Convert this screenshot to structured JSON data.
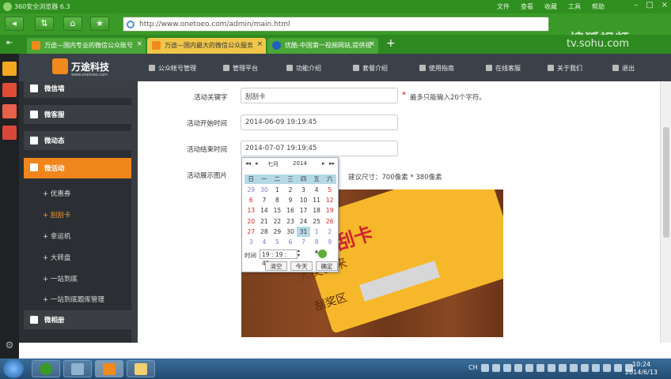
{
  "browser": {
    "title": "360安全浏览器 6.3",
    "menus": [
      "文件",
      "查看",
      "收藏",
      "工具",
      "帮助"
    ],
    "url": "http://www.onetoeo.com/admin/main.html",
    "watermark": "搜狐视频",
    "watermark_url": "tv.sohu.com",
    "tabs": [
      {
        "label": "万途—国内专业的微信公众账号"
      },
      {
        "label": "万途—国内最大的微信公众服务"
      },
      {
        "label": "优酷-中国第一视频网站,提供视"
      }
    ]
  },
  "site": {
    "brand": "万途科技",
    "brand_sub": "www.onetoeo.com",
    "nav": [
      "公众帐号管理",
      "管理平台",
      "功能介绍",
      "套餐介绍",
      "使用指南",
      "在线客服",
      "关于我们",
      "退出"
    ]
  },
  "sidebar": {
    "items": [
      "微信墙",
      "微客服",
      "微动态",
      "微活动",
      "微相册"
    ],
    "subitems": [
      "优惠券",
      "刮刮卡",
      "幸运机",
      "大转盘",
      "一站到底",
      "一站到底题库管理"
    ]
  },
  "form": {
    "keyword_label": "活动关键字",
    "keyword_value": "刮刮卡",
    "keyword_hint": "最多只能输入20个字符。",
    "start_label": "活动开始时间",
    "start_value": "2014-06-09 19:19:45",
    "end_label": "活动结束时间",
    "end_value": "2014-07-07 19:19:45",
    "image_label": "活动展示图片",
    "image_hint": "建议尺寸：700像素 * 380像素",
    "image_text_title": "刮卡",
    "image_text_mid": "大奖出来",
    "image_text_area": "刮奖区"
  },
  "calendar": {
    "month": "七月",
    "year": "2014",
    "weekdays": [
      "日",
      "一",
      "二",
      "三",
      "四",
      "五",
      "六"
    ],
    "days": [
      {
        "d": "29",
        "o": true
      },
      {
        "d": "30",
        "o": true
      },
      {
        "d": "1"
      },
      {
        "d": "2"
      },
      {
        "d": "3"
      },
      {
        "d": "4"
      },
      {
        "d": "5",
        "r": true
      },
      {
        "d": "6",
        "r": true
      },
      {
        "d": "7"
      },
      {
        "d": "8"
      },
      {
        "d": "9"
      },
      {
        "d": "10"
      },
      {
        "d": "11"
      },
      {
        "d": "12",
        "r": true
      },
      {
        "d": "13",
        "r": true
      },
      {
        "d": "14"
      },
      {
        "d": "15"
      },
      {
        "d": "16"
      },
      {
        "d": "17"
      },
      {
        "d": "18"
      },
      {
        "d": "19",
        "r": true
      },
      {
        "d": "20",
        "r": true
      },
      {
        "d": "21"
      },
      {
        "d": "22"
      },
      {
        "d": "23"
      },
      {
        "d": "24"
      },
      {
        "d": "25"
      },
      {
        "d": "26",
        "r": true
      },
      {
        "d": "27",
        "r": true
      },
      {
        "d": "28"
      },
      {
        "d": "29"
      },
      {
        "d": "30"
      },
      {
        "d": "31",
        "sel": true
      },
      {
        "d": "1",
        "o": true
      },
      {
        "d": "2",
        "o": true
      },
      {
        "d": "3",
        "o": true
      },
      {
        "d": "4",
        "o": true
      },
      {
        "d": "5",
        "o": true
      },
      {
        "d": "6",
        "o": true
      },
      {
        "d": "7",
        "o": true
      },
      {
        "d": "8",
        "o": true
      },
      {
        "d": "9",
        "o": true
      }
    ],
    "time_label": "时间",
    "time_value": "19 : 19 : 45",
    "btn_clear": "清空",
    "btn_today": "今天",
    "btn_ok": "确定"
  },
  "taskbar": {
    "time": "10:24",
    "date": "2014/6/13",
    "tray_ch": "CH"
  },
  "colors": {
    "accent": "#f0861c",
    "browser_green": "#3a9a28",
    "header_dark": "#3b4148"
  }
}
